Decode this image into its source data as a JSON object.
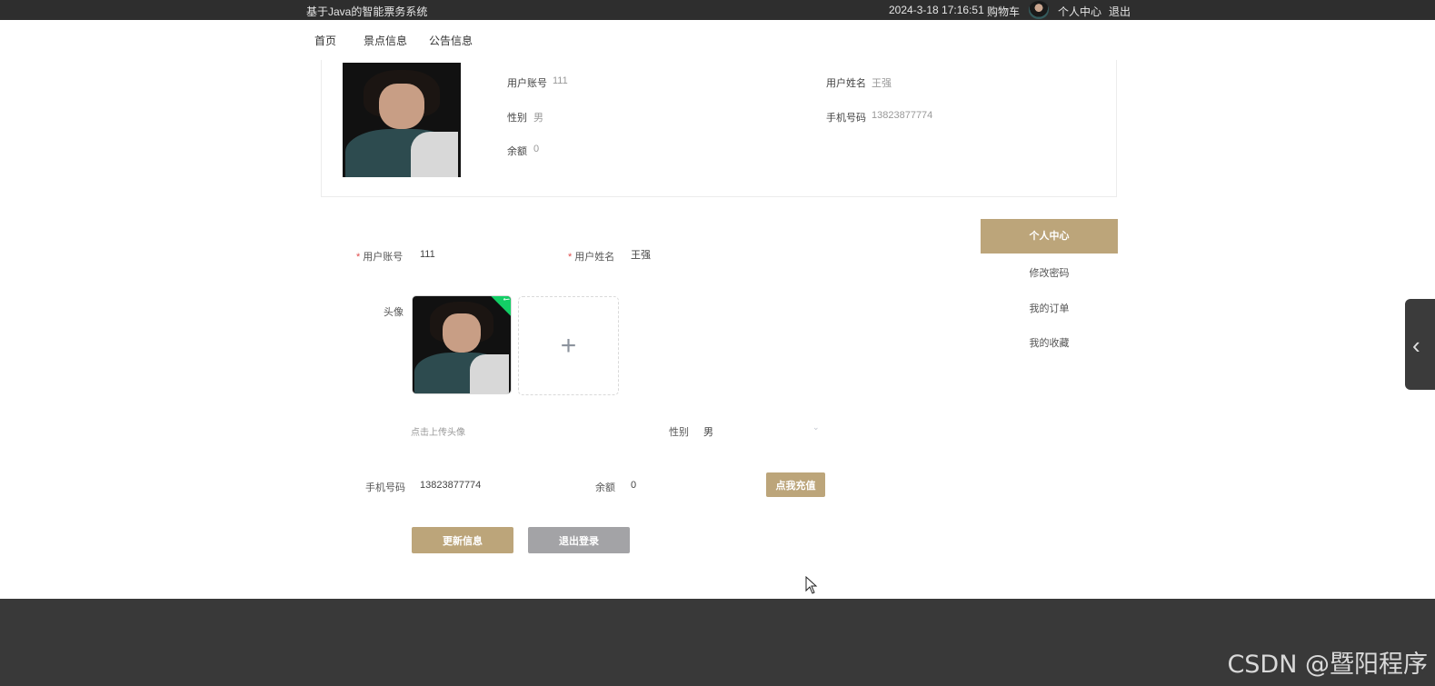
{
  "topbar": {
    "site_title": "基于Java的智能票务系统",
    "datetime": "2024-3-18 17:16:51",
    "cart": "购物车",
    "personal_center": "个人中心",
    "logout": "退出"
  },
  "nav": [
    "首页",
    "景点信息",
    "公告信息"
  ],
  "profile_card": {
    "account_label": "用户账号",
    "account_value": "111",
    "name_label": "用户姓名",
    "name_value": "王强",
    "gender_label": "性别",
    "gender_value": "男",
    "phone_label": "手机号码",
    "phone_value": "13823877774",
    "balance_label": "余额",
    "balance_value": "0"
  },
  "form": {
    "account_label": "用户账号",
    "account_value": "111",
    "name_label": "用户姓名",
    "name_value": "王强",
    "avatar_label": "头像",
    "upload_tip": "点击上传头像",
    "gender_label": "性别",
    "gender_value": "男",
    "phone_label": "手机号码",
    "phone_value": "13823877774",
    "balance_label": "余额",
    "balance_value": "0",
    "recharge_button": "点我充值",
    "update_button": "更新信息",
    "logout_button": "退出登录"
  },
  "side_menu": {
    "active": "个人中心",
    "items": [
      "修改密码",
      "我的订单",
      "我的收藏"
    ]
  },
  "watermark": "CSDN @暨阳程序",
  "colors": {
    "accent": "#bca57a",
    "topbar": "#2e2e2e",
    "footer": "#393939",
    "secondary_button": "#a3a3a6"
  }
}
